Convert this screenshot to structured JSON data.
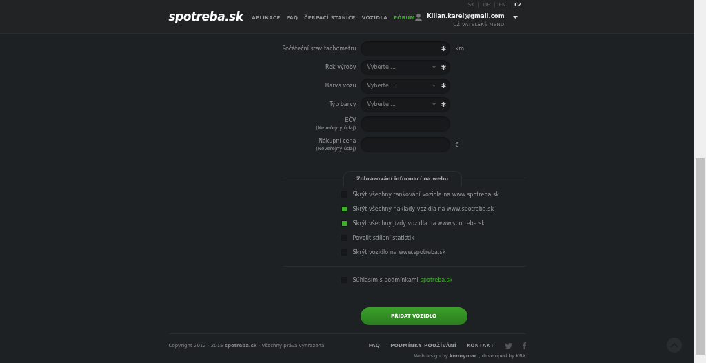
{
  "header": {
    "logo": "spotreba.sk",
    "nav": [
      {
        "label": "APLIKACE",
        "selected": false
      },
      {
        "label": "FAQ",
        "selected": false
      },
      {
        "label": "ČERPACÍ STANICE",
        "selected": false
      },
      {
        "label": "VOZIDLA",
        "selected": false
      },
      {
        "label": "FÓRUM",
        "selected": true
      }
    ],
    "languages": [
      {
        "label": "SK",
        "selected": false
      },
      {
        "label": "DE",
        "selected": false
      },
      {
        "label": "EN",
        "selected": false
      },
      {
        "label": "CZ",
        "selected": true
      }
    ],
    "user": {
      "email": "Kilian.karel@gmail.com",
      "menu_label": "UŽIVATELSKÉ MENU"
    }
  },
  "form": {
    "fields": [
      {
        "kind": "text",
        "label": "Počáteční stav tachometru",
        "required": true,
        "unit": "km"
      },
      {
        "kind": "select",
        "label": "Rok výroby",
        "placeholder": "Vyberte ...",
        "required": true
      },
      {
        "kind": "select",
        "label": "Barva vozu",
        "placeholder": "Vyberte ...",
        "required": true
      },
      {
        "kind": "select",
        "label": "Typ barvy",
        "placeholder": "Vyberte ...",
        "required": true
      },
      {
        "kind": "text",
        "label": "EČV",
        "sublabel": "(Neveřejný údaj)",
        "required": false
      },
      {
        "kind": "text",
        "label": "Nákupní cena",
        "sublabel": "(Neveřejný údaj)",
        "required": false,
        "unit": "€"
      }
    ],
    "section_title": "Zobrazování informací na webu",
    "options": [
      {
        "label": "Skrýt všechny tankování vozidla na www.spotreba.sk",
        "checked": false
      },
      {
        "label": "Skrýt všechny náklady vozidla na www.spotreba.sk",
        "checked": true
      },
      {
        "label": "Skrýt všechny jízdy vozidla na www.spotreba.sk",
        "checked": true
      },
      {
        "label": "Povolit sdílení statistik",
        "checked": false
      },
      {
        "label": "Skrýt vozidlo na www.spotreba.sk",
        "checked": false
      }
    ],
    "agree": {
      "text": "Súhlasím s podmínkami",
      "link": "spotreba.sk",
      "checked": false
    },
    "submit": "PŘIDAT VOZIDLO"
  },
  "footer": {
    "copyright": "Copyright 2012 - 2015 **spotreba.sk** - Všechny práva vyhrazena",
    "links": [
      "FAQ",
      "PODMÍNKY POUŽÍVÁNÍ",
      "KONTAKT"
    ],
    "credits": "Webdesign by **kennymac** , developed by KBX"
  }
}
